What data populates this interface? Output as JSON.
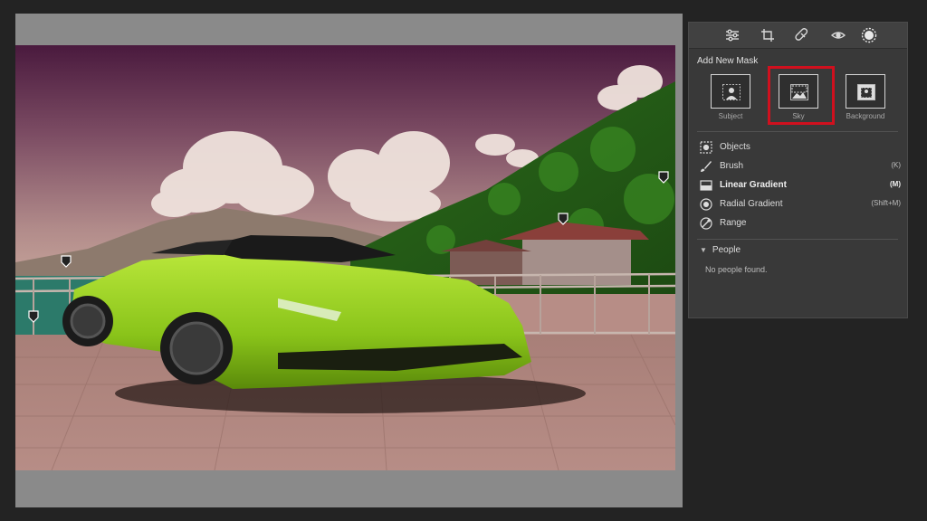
{
  "panel": {
    "toolbar_icons": [
      "sliders-icon",
      "crop-icon",
      "healing-brush-icon",
      "red-eye-icon",
      "masking-icon"
    ],
    "add_new_mask_title": "Add New Mask",
    "mask_buttons": [
      {
        "label": "Subject",
        "icon": "subject-icon"
      },
      {
        "label": "Sky",
        "icon": "sky-icon",
        "selected": true
      },
      {
        "label": "Background",
        "icon": "background-icon"
      }
    ],
    "tools": [
      {
        "label": "Objects",
        "shortcut": "",
        "icon": "objects-icon"
      },
      {
        "label": "Brush",
        "shortcut": "(K)",
        "icon": "brush-icon"
      },
      {
        "label": "Linear Gradient",
        "shortcut": "(M)",
        "icon": "linear-gradient-icon"
      },
      {
        "label": "Radial Gradient",
        "shortcut": "(Shift+M)",
        "icon": "radial-gradient-icon"
      },
      {
        "label": "Range",
        "shortcut": "",
        "icon": "range-icon"
      }
    ],
    "people": {
      "title": "People",
      "empty_text": "No people found."
    }
  },
  "colors": {
    "highlight": "#d0101e",
    "panel_bg": "#393939",
    "canvas_bg": "#8a8a8a",
    "app_bg": "#232323"
  }
}
